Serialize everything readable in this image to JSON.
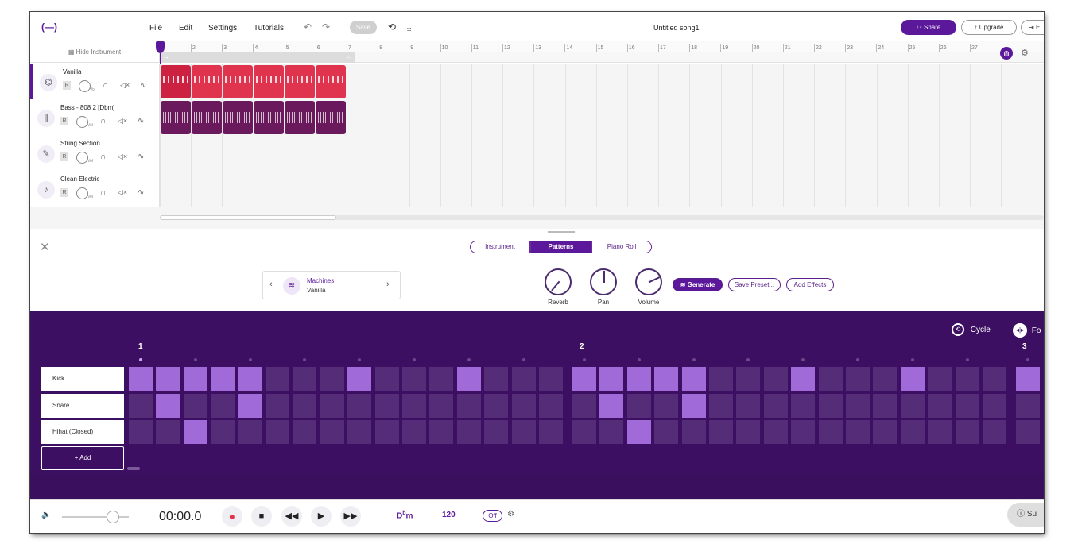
{
  "topbar": {
    "logo": "(—)",
    "menu": [
      "File",
      "Edit",
      "Settings",
      "Tutorials"
    ],
    "save_label": "Save",
    "song_title": "Untitled song1",
    "share_label": "Share",
    "upgrade_label": "Upgrade",
    "export_label": "E"
  },
  "timeline": {
    "hide_instrument_label": "Hide Instrument",
    "bars": [
      "2",
      "3",
      "4",
      "5",
      "6",
      "7",
      "8",
      "9",
      "10",
      "11",
      "12",
      "13",
      "14",
      "15",
      "16",
      "17",
      "18",
      "19",
      "20",
      "21",
      "22",
      "23",
      "24",
      "25",
      "26",
      "27"
    ]
  },
  "tracks": [
    {
      "name": "Vanilla",
      "icon": "drum-machine-icon",
      "record_label": "R",
      "vol_label": "Vol"
    },
    {
      "name": "Bass - 808 2 [Dbm]",
      "icon": "waveform-icon",
      "record_label": "R",
      "vol_label": "Vol"
    },
    {
      "name": "String Section",
      "icon": "violin-icon",
      "record_label": "R",
      "vol_label": "Vol"
    },
    {
      "name": "Clean Electric",
      "icon": "guitar-icon",
      "record_label": "R",
      "vol_label": "Vol"
    }
  ],
  "panel": {
    "tabs": [
      "Instrument",
      "Patterns",
      "Piano Roll"
    ],
    "active_tab": "Patterns",
    "preset_category": "Machines",
    "preset_name": "Vanilla",
    "knobs": [
      {
        "label": "Reverb",
        "value": 0.15
      },
      {
        "label": "Pan",
        "value": 0.5
      },
      {
        "label": "Volume",
        "value": 0.75
      }
    ],
    "generate_label": "Generate",
    "save_preset_label": "Save Preset...",
    "add_effects_label": "Add Effects"
  },
  "sequencer": {
    "cycle_label": "Cycle",
    "follow_label": "Fo",
    "bar_labels": [
      "1",
      "2",
      "3"
    ],
    "rows": [
      {
        "name": "Kick",
        "steps": [
          1,
          1,
          1,
          1,
          1,
          0,
          0,
          0,
          1,
          0,
          0,
          0,
          1,
          0,
          0,
          0,
          1,
          1,
          1,
          1,
          1,
          0,
          0,
          0,
          1,
          0,
          0,
          0,
          1,
          0,
          0,
          0,
          1
        ]
      },
      {
        "name": "Snare",
        "steps": [
          0,
          1,
          0,
          0,
          1,
          0,
          0,
          0,
          0,
          0,
          0,
          0,
          0,
          0,
          0,
          0,
          0,
          1,
          0,
          0,
          1,
          0,
          0,
          0,
          0,
          0,
          0,
          0,
          0,
          0,
          0,
          0,
          0
        ]
      },
      {
        "name": "Hihat (Closed)",
        "steps": [
          0,
          0,
          1,
          0,
          0,
          0,
          0,
          0,
          0,
          0,
          0,
          0,
          0,
          0,
          0,
          0,
          0,
          0,
          1,
          0,
          0,
          0,
          0,
          0,
          0,
          0,
          0,
          0,
          0,
          0,
          0,
          0,
          0
        ]
      }
    ],
    "add_label": "+ Add"
  },
  "transport": {
    "time": "00:00.0",
    "key_root": "D",
    "key_accidental": "b",
    "key_mode": "m",
    "tempo": "120",
    "metronome_label": "Off",
    "support_label": "Su"
  },
  "colors": {
    "accent": "#5b189b",
    "seq_bg": "#3d0f62",
    "step_on": "#a06ad8",
    "step_off": "#552c78",
    "clip_red": "#e0334e",
    "clip_purple": "#6a1a5c"
  }
}
